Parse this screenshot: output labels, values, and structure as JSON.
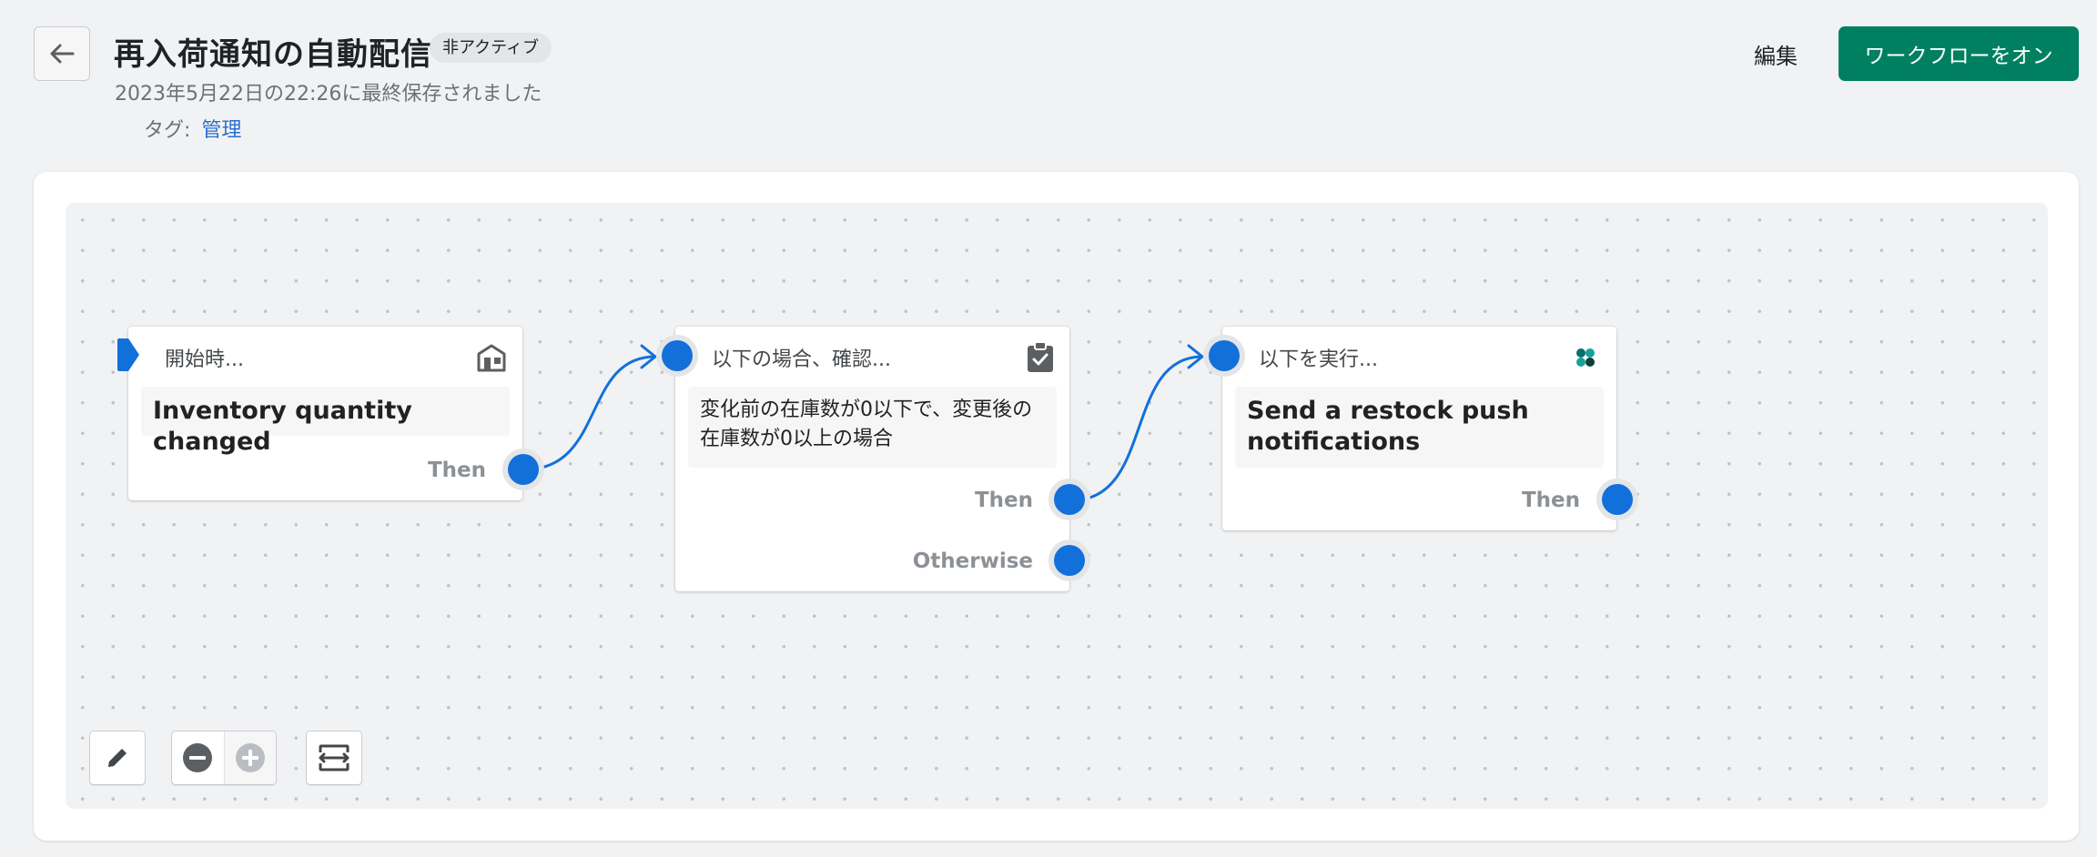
{
  "header": {
    "title": "再入荷通知の自動配信",
    "status": "非アクティブ",
    "saved_text": "2023年5月22日の22:26に最終保存されました",
    "tags_label": "タグ:",
    "tag": "管理",
    "edit_label": "編集",
    "turn_on_label": "ワークフローをオン"
  },
  "nodes": {
    "trigger": {
      "heading": "開始時...",
      "title": "Inventory quantity changed",
      "output_then": "Then",
      "icon": "store-icon"
    },
    "condition": {
      "heading": "以下の場合、確認...",
      "text": "変化前の在庫数が0以下で、変更後の在庫数が0以上の場合",
      "output_then": "Then",
      "output_otherwise": "Otherwise",
      "icon": "clipboard-check-icon"
    },
    "action": {
      "heading": "以下を実行...",
      "title": "Send a restock push notifications",
      "output_then": "Then",
      "icon": "app-logo-icon"
    }
  },
  "toolbar": {
    "edit_icon": "pencil-icon",
    "zoom_out_icon": "minus-circle-icon",
    "zoom_in_icon": "plus-circle-icon",
    "fit_icon": "fit-view-icon"
  },
  "colors": {
    "primary": "#008060",
    "port": "#1270db",
    "link": "#2c6ecb"
  }
}
